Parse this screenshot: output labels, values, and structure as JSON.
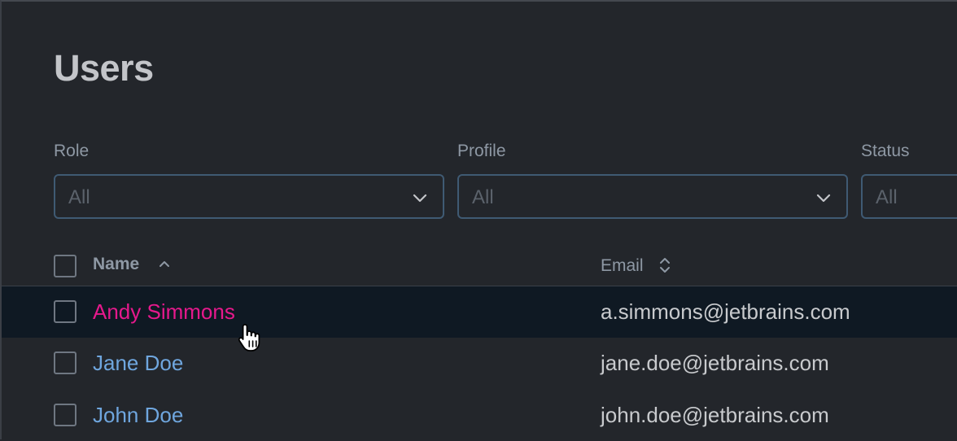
{
  "page": {
    "title": "Users"
  },
  "filters": [
    {
      "label": "Role",
      "value": "All",
      "icon": "chevron-down-icon"
    },
    {
      "label": "Profile",
      "value": "All",
      "icon": "chevron-down-icon"
    },
    {
      "label": "Status",
      "value": "All",
      "icon": "chevron-down-icon"
    }
  ],
  "table": {
    "columns": [
      {
        "label": "Name",
        "sort": "ascending",
        "icon": "sort-ascending-icon"
      },
      {
        "label": "Email",
        "sort": "none",
        "icon": "sort-icon"
      }
    ],
    "rows": [
      {
        "name": "Andy Simmons",
        "email": "a.simmons@jetbrains.com",
        "state": "hovered"
      },
      {
        "name": "Jane Doe",
        "email": "jane.doe@jetbrains.com",
        "state": "normal"
      },
      {
        "name": "John Doe",
        "email": "john.doe@jetbrains.com",
        "state": "normal"
      }
    ]
  },
  "colors": {
    "background": "#23262b",
    "link": "#6fa6de",
    "link_hover": "#e6198c",
    "row_hover_bg": "#0f1923",
    "select_border": "#3f5a73"
  },
  "cursor": {
    "icon": "hand-pointer-icon"
  }
}
